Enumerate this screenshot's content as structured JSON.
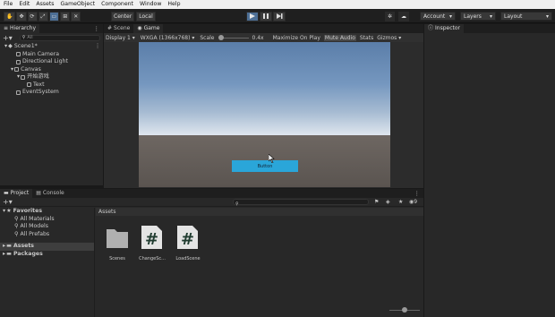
{
  "menu": [
    "File",
    "Edit",
    "Assets",
    "GameObject",
    "Component",
    "Window",
    "Help"
  ],
  "toolbar": {
    "center_label": "Center",
    "local_label": "Local",
    "account_label": "Account",
    "layers_label": "Layers",
    "layout_label": "Layout"
  },
  "hierarchy": {
    "tab_label": "Hierarchy",
    "search_placeholder": "All",
    "scene": "Scene1*",
    "items": [
      "Main Camera",
      "Directional Light",
      "Canvas",
      "开始游戏",
      "Text",
      "EventSystem"
    ]
  },
  "scene_tab": "Scene",
  "game": {
    "tab_label": "Game",
    "display": "Display 1",
    "resolution": "WXGA (1366x768)",
    "scale_label": "Scale",
    "scale_value": "0.4x",
    "maximize": "Maximize On Play",
    "mute": "Mute Audio",
    "stats": "Stats",
    "gizmos": "Gizmos",
    "button_text": "Button"
  },
  "inspector": {
    "tab_label": "Inspector"
  },
  "project": {
    "tab_label": "Project",
    "console_label": "Console",
    "favorites": "Favorites",
    "fav_items": [
      "All Materials",
      "All Models",
      "All Prefabs"
    ],
    "assets_label": "Assets",
    "packages_label": "Packages",
    "breadcrumb": "Assets",
    "files": [
      {
        "name": "Scenes",
        "type": "folder"
      },
      {
        "name": "ChangeSc...",
        "type": "script"
      },
      {
        "name": "LoadScene",
        "type": "script"
      }
    ]
  },
  "colors": {
    "accent": "#3d87c7",
    "ui_button": "#2aa6d9"
  }
}
